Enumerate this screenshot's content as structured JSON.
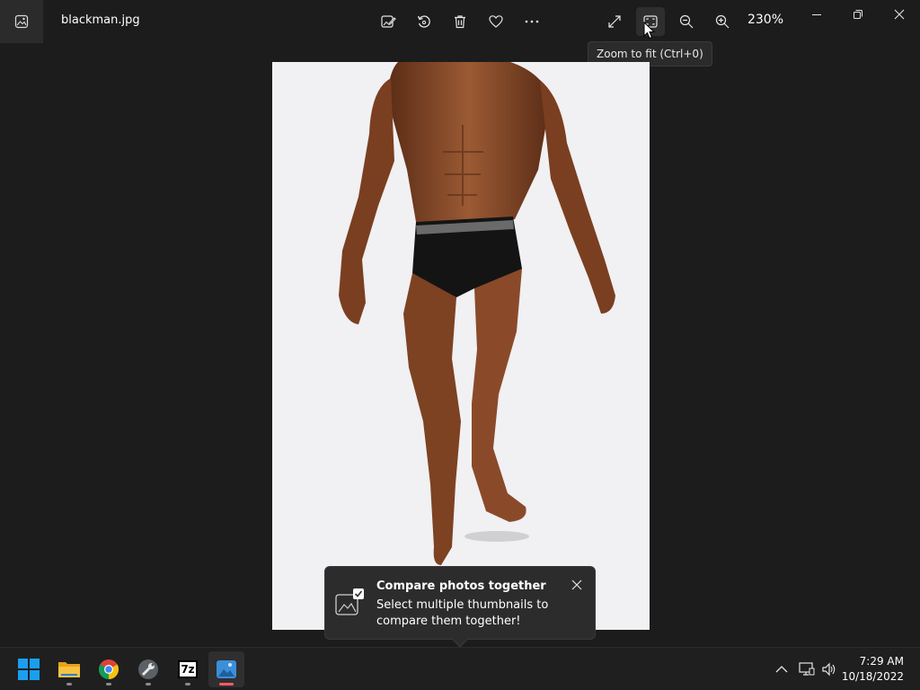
{
  "window": {
    "filename": "blackman.jpg",
    "zoom_level": "230%",
    "tooltip": "Zoom to fit (Ctrl+0)"
  },
  "toolbar": {
    "icons": [
      "edit-image-icon",
      "rotate-icon",
      "delete-icon",
      "favorite-icon",
      "more-icon",
      "fullscreen-icon",
      "zoom-to-fit-icon",
      "zoom-out-icon",
      "zoom-in-icon"
    ]
  },
  "window_controls": [
    "minimize-icon",
    "restore-icon",
    "close-icon"
  ],
  "teaching_tip": {
    "title": "Compare photos together",
    "body": "Select multiple thumbnails to compare them together!"
  },
  "taskbar": {
    "apps": [
      "start",
      "file-explorer",
      "chrome",
      "tool-app",
      "7zip",
      "photos"
    ],
    "sevenzip_label": "7z",
    "time": "7:29 AM",
    "date": "10/18/2022"
  },
  "colors": {
    "background": "#1c1c1c",
    "photo_background": "#f1f0f2",
    "skin": "#8a4a2a",
    "active_indicator": "#ff5a6a",
    "windows_blue": "#1a9ff0"
  }
}
